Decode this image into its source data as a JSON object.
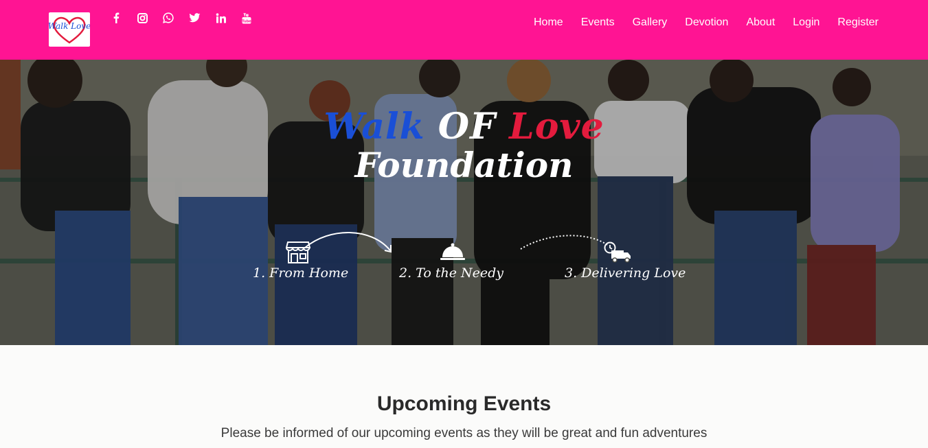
{
  "brand": {
    "logo_alt": "Walk of Love logo",
    "logo_text": "Walk Love"
  },
  "social": [
    {
      "name": "facebook-icon"
    },
    {
      "name": "instagram-icon"
    },
    {
      "name": "whatsapp-icon"
    },
    {
      "name": "twitter-icon"
    },
    {
      "name": "linkedin-icon"
    },
    {
      "name": "youtube-icon"
    }
  ],
  "nav": {
    "items": [
      "Home",
      "Events",
      "Gallery",
      "Devotion",
      "About",
      "Login",
      "Register"
    ]
  },
  "hero": {
    "title_part1": "Walk",
    "title_part2": "OF",
    "title_part3": "Love",
    "title_line2": "Foundation",
    "steps": [
      {
        "label": "1. From Home",
        "icon": "shop-icon"
      },
      {
        "label": "2. To the Needy",
        "icon": "serving-bell-icon"
      },
      {
        "label": "3. Delivering Love",
        "icon": "delivery-truck-icon"
      }
    ]
  },
  "events": {
    "title": "Upcoming Events",
    "subtitle": "Please be informed of our upcoming events as they will be great and fun adventures"
  },
  "colors": {
    "navbar": "#ff1493",
    "title_blue": "#1a4fd6",
    "title_red": "#e31b3d"
  }
}
